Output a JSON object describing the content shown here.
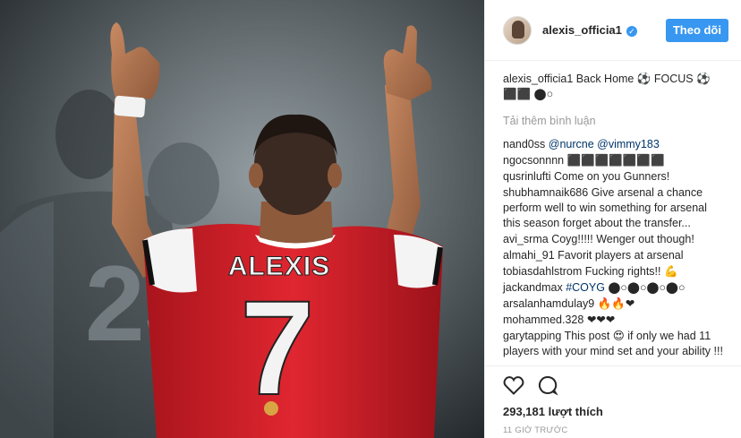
{
  "post": {
    "username": "alexis_officia1",
    "follow_label": "Theo dõi",
    "caption": {
      "user": "alexis_officia1",
      "text": "Back Home ⚽ FOCUS ⚽ ⬛⬛ ⬤○"
    },
    "load_more": "Tải thêm bình luận",
    "comments": [
      {
        "user": "nand0ss",
        "mention": "@nurcne @vimmy183"
      },
      {
        "user": "ngocsonnnn",
        "text": "⬛⬛⬛⬛⬛⬛⬛"
      },
      {
        "user": "qusrinlufti",
        "text": "Come on you Gunners!"
      },
      {
        "user": "shubhamnaik686",
        "text": "Give arsenal a chance perform well to win something for arsenal this season forget about the transfer..."
      },
      {
        "user": "avi_srma",
        "text": "Coyg!!!!! Wenger out though!"
      },
      {
        "user": "almahi_91",
        "text": "Favorit players at arsenal"
      },
      {
        "user": "tobiasdahlstrom",
        "text": "Fucking rights!! 💪"
      },
      {
        "user": "jackandmax",
        "mention": "#COYG",
        "text": "⬤○⬤○⬤○⬤○"
      },
      {
        "user": "arsalanhamdulay9",
        "text": "🔥🔥❤"
      },
      {
        "user": "mohammed.328",
        "text": "❤❤❤"
      },
      {
        "user": "garytapping",
        "text": "This post 😍 if only we had 11 players with your mind set and your ability !!!"
      }
    ],
    "likes": "293,181 lượt thích",
    "time": "11 GIỜ TRƯỚC",
    "jersey": {
      "name": "ALEXIS",
      "number": "7"
    },
    "background_number": "23",
    "colors": {
      "accent": "#3897f0",
      "shirt_red": "#d61c26",
      "mention": "#003569"
    }
  }
}
